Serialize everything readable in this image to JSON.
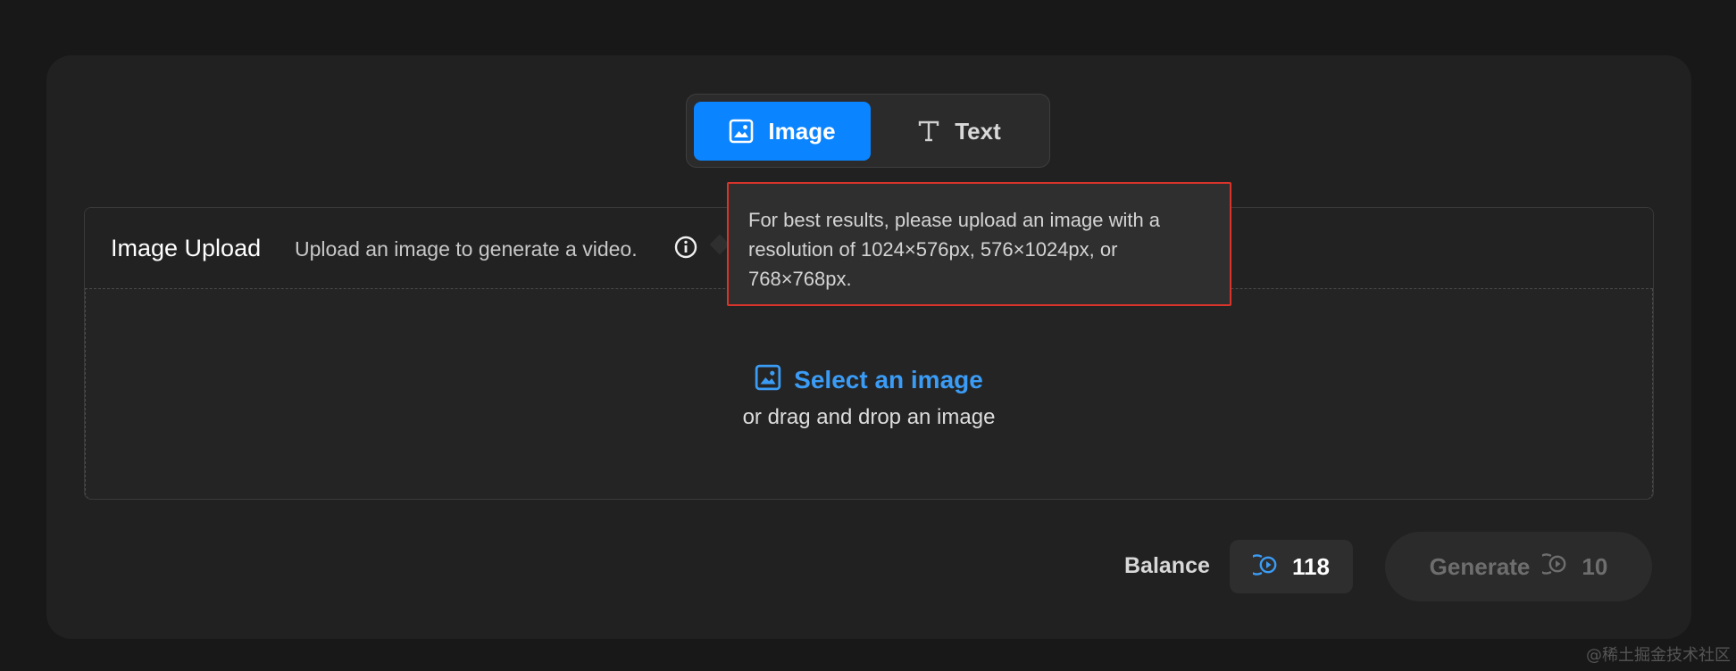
{
  "toggle": {
    "tabs": [
      {
        "label": "Image",
        "icon": "image-icon",
        "active": true
      },
      {
        "label": "Text",
        "icon": "text-icon",
        "active": false
      }
    ]
  },
  "upload": {
    "title": "Image Upload",
    "description": "Upload an image to generate a video.",
    "select_label": "Select an image",
    "drag_label": "or drag and drop an image"
  },
  "tooltip": {
    "text": "For best results, please upload an image with a resolution of 1024×576px, 576×1024px, or 768×768px."
  },
  "footer": {
    "balance_label": "Balance",
    "balance_value": "118",
    "generate_label": "Generate",
    "generate_cost": "10"
  },
  "watermark": "@稀土掘金技术社区",
  "colors": {
    "accent": "#0a84ff",
    "link": "#3b9cf6",
    "highlight_border": "#d9342b",
    "background": "#181818",
    "panel": "#212121"
  }
}
